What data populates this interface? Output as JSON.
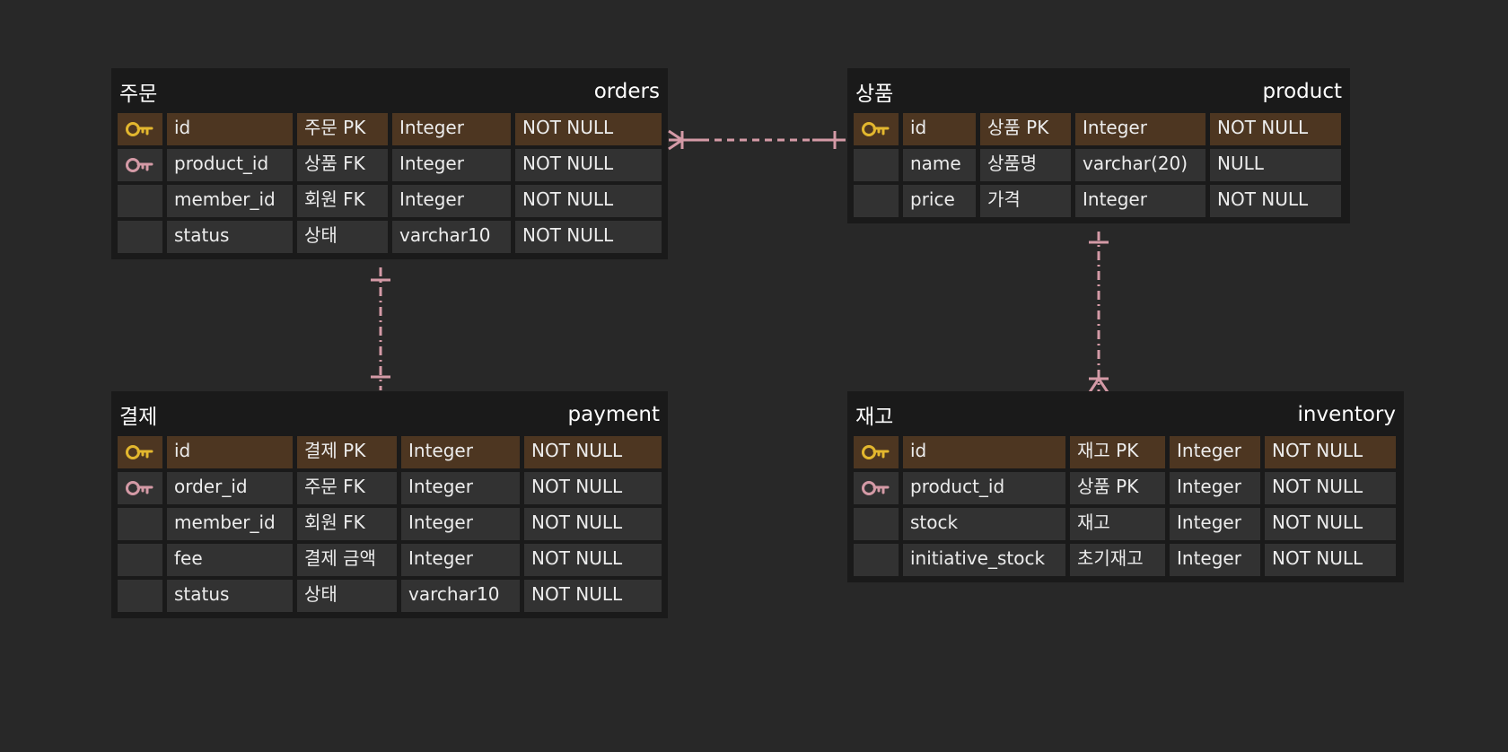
{
  "colors": {
    "background": "#282828",
    "table": "#1a1a1a",
    "cell": "#323232",
    "pk_row": "#4d3621",
    "pk_key": "#e3b72e",
    "fk_key": "#d49aa6",
    "relation": "#d49aa6"
  },
  "tables": {
    "orders": {
      "logical": "주문",
      "physical": "orders",
      "rows": [
        {
          "key": "pk-key-icon",
          "name": "id",
          "comment": "주문 PK",
          "type": "Integer",
          "nullable": "NOT NULL"
        },
        {
          "key": "fk-key-icon",
          "name": "product_id",
          "comment": "상품 FK",
          "type": "Integer",
          "nullable": "NOT NULL"
        },
        {
          "key": "",
          "name": "member_id",
          "comment": "회원 FK",
          "type": "Integer",
          "nullable": "NOT NULL"
        },
        {
          "key": "",
          "name": "status",
          "comment": "상태",
          "type": "varchar10",
          "nullable": "NOT NULL"
        }
      ]
    },
    "product": {
      "logical": "상품",
      "physical": "product",
      "rows": [
        {
          "key": "pk-key-icon",
          "name": "id",
          "comment": "상품 PK",
          "type": "Integer",
          "nullable": "NOT NULL"
        },
        {
          "key": "",
          "name": "name",
          "comment": "상품명",
          "type": "varchar(20)",
          "nullable": "NULL"
        },
        {
          "key": "",
          "name": "price",
          "comment": "가격",
          "type": "Integer",
          "nullable": "NOT NULL"
        }
      ]
    },
    "payment": {
      "logical": "결제",
      "physical": "payment",
      "rows": [
        {
          "key": "pk-key-icon",
          "name": "id",
          "comment": "결제 PK",
          "type": "Integer",
          "nullable": "NOT NULL"
        },
        {
          "key": "fk-key-icon",
          "name": "order_id",
          "comment": "주문 FK",
          "type": "Integer",
          "nullable": "NOT NULL"
        },
        {
          "key": "",
          "name": "member_id",
          "comment": "회원 FK",
          "type": "Integer",
          "nullable": "NOT NULL"
        },
        {
          "key": "",
          "name": "fee",
          "comment": "결제 금액",
          "type": "Integer",
          "nullable": "NOT NULL"
        },
        {
          "key": "",
          "name": "status",
          "comment": "상태",
          "type": "varchar10",
          "nullable": "NOT NULL"
        }
      ]
    },
    "inventory": {
      "logical": "재고",
      "physical": "inventory",
      "rows": [
        {
          "key": "pk-key-icon",
          "name": "id",
          "comment": "재고 PK",
          "type": "Integer",
          "nullable": "NOT NULL"
        },
        {
          "key": "fk-key-icon",
          "name": "product_id",
          "comment": "상품 PK",
          "type": "Integer",
          "nullable": "NOT NULL"
        },
        {
          "key": "",
          "name": "stock",
          "comment": "재고",
          "type": "Integer",
          "nullable": "NOT NULL"
        },
        {
          "key": "",
          "name": "initiative_stock",
          "comment": "초기재고",
          "type": "Integer",
          "nullable": "NOT NULL"
        }
      ]
    }
  },
  "relations": [
    {
      "from": "orders",
      "from_card": "many",
      "to": "product",
      "to_card": "one"
    },
    {
      "from": "orders",
      "from_card": "one",
      "to": "payment",
      "to_card": "one"
    },
    {
      "from": "product",
      "from_card": "one",
      "to": "inventory",
      "to_card": "many"
    }
  ]
}
